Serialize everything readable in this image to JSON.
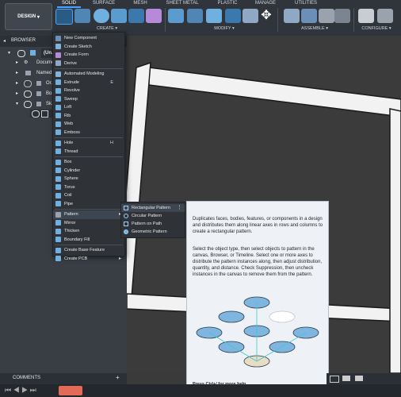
{
  "design_label": "DESIGN",
  "tabs": [
    "SOLID",
    "SURFACE",
    "MESH",
    "SHEET METAL",
    "PLASTIC",
    "MANAGE",
    "UTILITIES"
  ],
  "groups": {
    "create": "CREATE",
    "modify": "MODIFY",
    "assemble": "ASSEMBLE",
    "configure": "CONFIGURE"
  },
  "browser": {
    "title": "BROWSER",
    "root": "(Un...",
    "items": [
      "Docume...",
      "Named",
      "Or...",
      "Bo...",
      "Sk..."
    ]
  },
  "menu": [
    {
      "label": "New Component",
      "icon": "new-component-icon",
      "color": "#6b8fb7"
    },
    {
      "label": "Create Sketch",
      "icon": "sketch-icon",
      "color": "#7fb3d9"
    },
    {
      "label": "Create Form",
      "icon": "form-icon",
      "color": "#b48ad9"
    },
    {
      "label": "Derive",
      "icon": "derive-icon",
      "color": "#8fa9c4"
    },
    {
      "sep": true
    },
    {
      "label": "Automated Modeling",
      "icon": "automated-modeling-icon",
      "color": "#7fb3d9"
    },
    {
      "label": "Extrude",
      "icon": "extrude-icon",
      "color": "#6fb0e0",
      "shortcut": "E"
    },
    {
      "label": "Revolve",
      "icon": "revolve-icon",
      "color": "#6fb0e0"
    },
    {
      "label": "Sweep",
      "icon": "sweep-icon",
      "color": "#6fb0e0"
    },
    {
      "label": "Loft",
      "icon": "loft-icon",
      "color": "#6fb0e0"
    },
    {
      "label": "Rib",
      "icon": "rib-icon",
      "color": "#6fb0e0"
    },
    {
      "label": "Web",
      "icon": "web-icon",
      "color": "#6fb0e0"
    },
    {
      "label": "Emboss",
      "icon": "emboss-icon",
      "color": "#6fb0e0"
    },
    {
      "sep": true
    },
    {
      "label": "Hole",
      "icon": "hole-icon",
      "color": "#6fb0e0",
      "shortcut": "H"
    },
    {
      "label": "Thread",
      "icon": "thread-icon",
      "color": "#6fb0e0"
    },
    {
      "sep": true
    },
    {
      "label": "Box",
      "icon": "box-icon",
      "color": "#6fb0e0"
    },
    {
      "label": "Cylinder",
      "icon": "cylinder-icon",
      "color": "#6fb0e0"
    },
    {
      "label": "Sphere",
      "icon": "sphere-icon",
      "color": "#6fb0e0"
    },
    {
      "label": "Torus",
      "icon": "torus-icon",
      "color": "#6fb0e0"
    },
    {
      "label": "Coil",
      "icon": "coil-icon",
      "color": "#6fb0e0"
    },
    {
      "label": "Pipe",
      "icon": "pipe-icon",
      "color": "#6fb0e0"
    },
    {
      "sep": true
    },
    {
      "label": "Pattern",
      "icon": "pattern-icon",
      "color": "#9aa3ad",
      "arrow": true,
      "highlight": true
    },
    {
      "label": "Mirror",
      "icon": "mirror-icon",
      "color": "#6fb0e0"
    },
    {
      "label": "Thicken",
      "icon": "thicken-icon",
      "color": "#6fb0e0"
    },
    {
      "label": "Boundary Fill",
      "icon": "boundary-fill-icon",
      "color": "#6fb0e0"
    },
    {
      "sep": true
    },
    {
      "label": "Create Base Feature",
      "icon": "base-feature-icon",
      "color": "#6fb0e0"
    },
    {
      "label": "Create PCB",
      "icon": "pcb-icon",
      "color": "#6fb0e0",
      "arrow": true
    }
  ],
  "submenu": [
    "Rectangular Pattern",
    "Circular Pattern",
    "Pattern on Path",
    "Geometric Pattern"
  ],
  "tooltip": {
    "p1": "Duplicates faces, bodies, features, or components in a design and distributes them along linear axes in rows and columns to create a rectangular pattern.",
    "p2": "Select the object type, then select objects to pattern in the canvas, Browser, or Timeline. Select one or more axes to distribute the pattern instances along, then adjust distribution, quantity, and distance. Check Suppression, then uncheck instances in the canvas to remove them from the pattern.",
    "help": "Press Ctrl+/ for more help."
  },
  "comments_label": "COMMENTS",
  "colors": {
    "accent": "#4aa3ff",
    "toolbar": "#30353b",
    "menu": "#2f3338"
  }
}
